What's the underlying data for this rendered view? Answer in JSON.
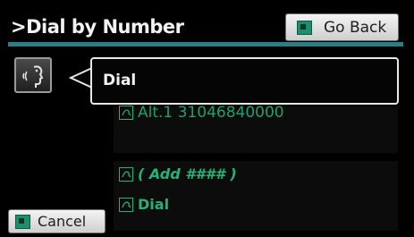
{
  "header": {
    "title": ">Dial by Number",
    "go_back_label": "Go Back"
  },
  "voice_prompt": {
    "text": "Dial"
  },
  "list": {
    "alt_item": "Alt.1 31046840000",
    "add_item": "( Add #### )",
    "dial_item": "Dial"
  },
  "footer": {
    "cancel_label": "Cancel"
  },
  "colors": {
    "accent_teal": "#2a7f86",
    "item_green": "#22b37a",
    "button_swatch": "#1d8f6c"
  },
  "icons": {
    "voice": "voice-speaker-icon",
    "speech": "speech-command-icon",
    "button": "button-swatch-icon"
  }
}
